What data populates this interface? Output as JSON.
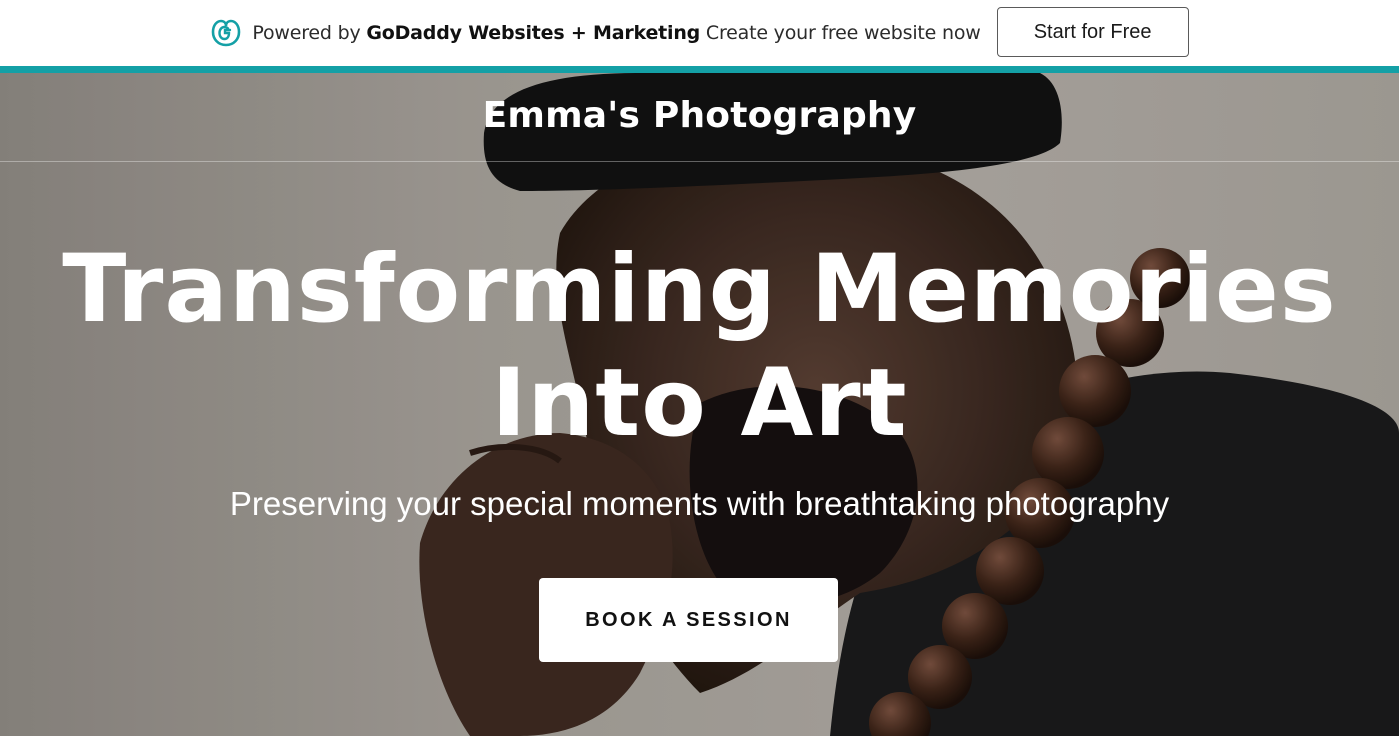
{
  "promo": {
    "logo_icon": "godaddy-logo-icon",
    "prefix": "Powered by",
    "brand": "GoDaddy Websites + Marketing",
    "suffix": "Create your free website now",
    "cta_label": "Start for Free",
    "accent_color": "#14a0a6"
  },
  "site": {
    "title": "Emma's Photography"
  },
  "hero": {
    "headline_line1": "Transforming Memories",
    "headline_line2": "Into Art",
    "subheadline": "Preserving your special moments with breathtaking photography",
    "cta_label": "BOOK A SESSION",
    "background_image": "man-with-beaded-necklace-photo"
  }
}
